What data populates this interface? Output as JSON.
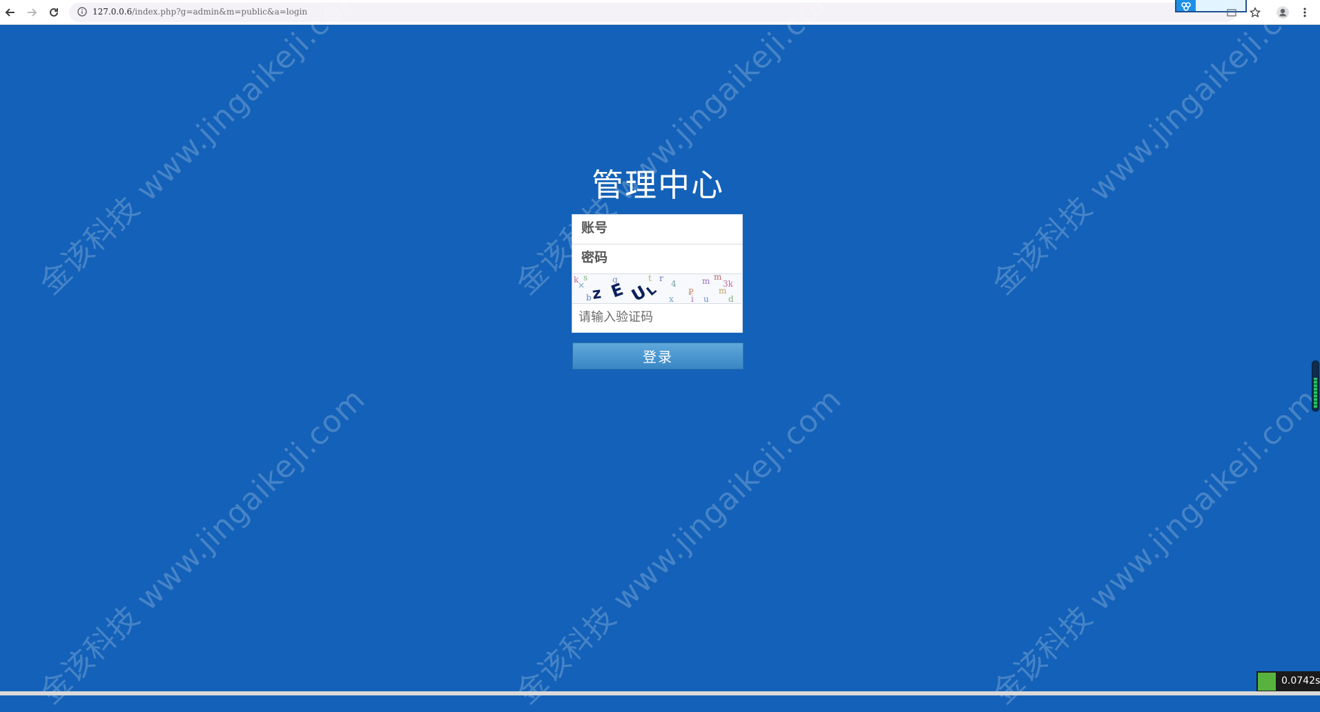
{
  "browser": {
    "url_host": "127.0.0.6",
    "url_path": "/index.php?g=admin&m=public&a=login"
  },
  "watermark": {
    "text": "金该科技 www.jingaikeji.com"
  },
  "login": {
    "title": "管理中心",
    "username_placeholder": "账号",
    "password_placeholder": "密码",
    "captcha_placeholder": "请输入验证码",
    "submit_label": "登录"
  },
  "timer": {
    "text": "0.0742s"
  },
  "colors": {
    "page_background": "#1361b8",
    "button_top": "#5fa8db",
    "button_bottom": "#3a86c4"
  }
}
